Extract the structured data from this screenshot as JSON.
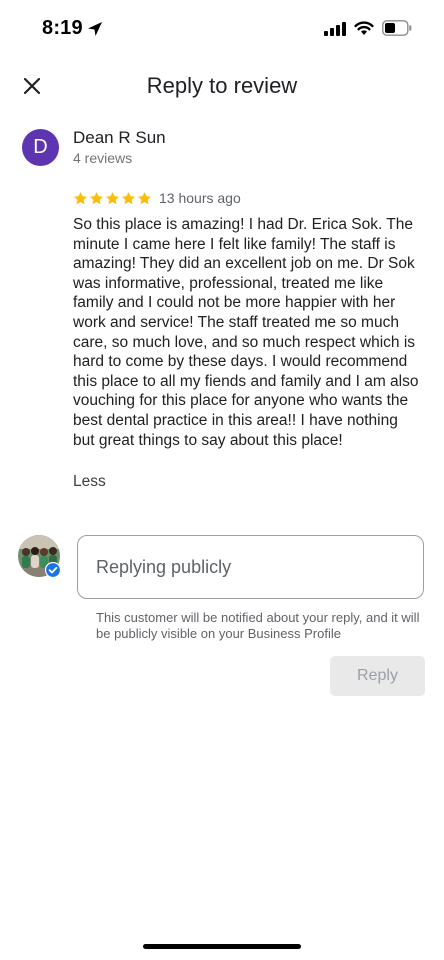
{
  "status_bar": {
    "time": "8:19",
    "icons": [
      "location-arrow-icon",
      "cellular-signal-icon",
      "wifi-icon",
      "battery-icon"
    ]
  },
  "header": {
    "title": "Reply to review",
    "close_icon": "close-icon"
  },
  "review": {
    "avatar_letter": "D",
    "avatar_color": "#5e35b1",
    "reviewer_name": "Dean R Sun",
    "reviewer_reviews": "4 reviews",
    "rating": 5,
    "star_color": "#fbbc04",
    "time_ago": "13 hours ago",
    "text": "So this place is amazing! I had Dr. Erica Sok. The minute I came here I felt like family! The staff is amazing! They did an excellent job on me. Dr Sok was informative, professional, treated me like family and I could not be more happier with her work and service! The staff treated me so much care, so much love, and so much respect which is hard to come by these days. I would recommend this place to all my fiends and family and I am also vouching for this place for anyone who wants the best dental practice in this area!! I have nothing but great things to say about this place!",
    "less_label": "Less"
  },
  "reply": {
    "placeholder": "Replying publicly",
    "value": "",
    "note": "This customer will be notified about your reply, and it will be publicly visible on your Business Profile",
    "button_label": "Reply",
    "verified_color": "#1a73e8"
  }
}
